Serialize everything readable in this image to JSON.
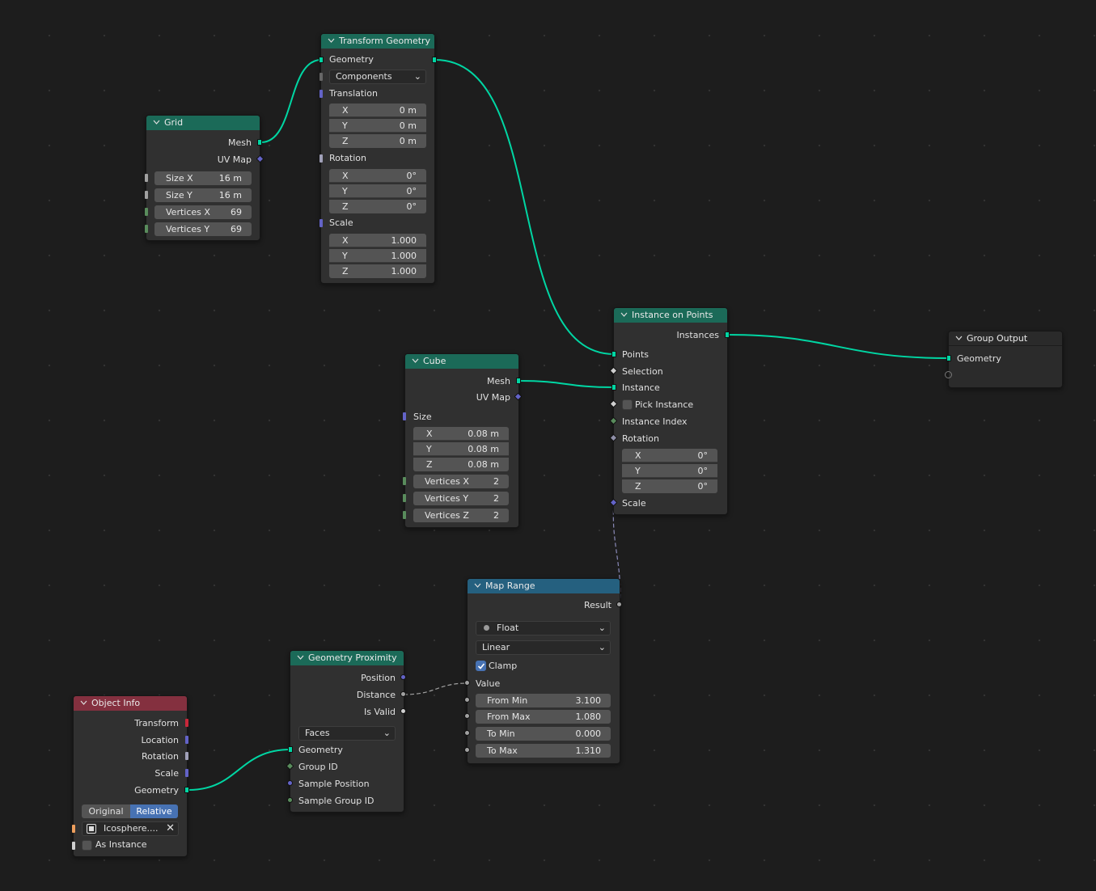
{
  "colors": {
    "background": "#1d1d1d",
    "geometry_header": "#1b6a58",
    "converter_header": "#25607f",
    "input_header": "#84303f",
    "geometry_socket": "#00d6a3",
    "vector_socket": "#6363c7",
    "float_socket": "#a1a1a1",
    "integer_socket": "#598c5c",
    "accent_selected": "#4772b3"
  },
  "nodes": {
    "transform": {
      "title": "Transform Geometry",
      "geometry": "Geometry",
      "mode": "Components",
      "translation": "Translation",
      "translation_values": [
        {
          "axis": "X",
          "value": "0 m"
        },
        {
          "axis": "Y",
          "value": "0 m"
        },
        {
          "axis": "Z",
          "value": "0 m"
        }
      ],
      "rotation": "Rotation",
      "rotation_values": [
        {
          "axis": "X",
          "value": "0°"
        },
        {
          "axis": "Y",
          "value": "0°"
        },
        {
          "axis": "Z",
          "value": "0°"
        }
      ],
      "scale": "Scale",
      "scale_values": [
        {
          "axis": "X",
          "value": "1.000"
        },
        {
          "axis": "Y",
          "value": "1.000"
        },
        {
          "axis": "Z",
          "value": "1.000"
        }
      ]
    },
    "grid": {
      "title": "Grid",
      "mesh": "Mesh",
      "uvmap": "UV Map",
      "fields": [
        {
          "name": "Size X",
          "value": "16 m"
        },
        {
          "name": "Size Y",
          "value": "16 m"
        },
        {
          "name": "Vertices X",
          "value": "69"
        },
        {
          "name": "Vertices Y",
          "value": "69"
        }
      ]
    },
    "instance": {
      "title": "Instance on Points",
      "instances": "Instances",
      "points": "Points",
      "selection": "Selection",
      "instance": "Instance",
      "pick_instance": "Pick Instance",
      "instance_index": "Instance Index",
      "rotation": "Rotation",
      "rotation_values": [
        {
          "axis": "X",
          "value": "0°"
        },
        {
          "axis": "Y",
          "value": "0°"
        },
        {
          "axis": "Z",
          "value": "0°"
        }
      ],
      "scale": "Scale"
    },
    "output": {
      "title": "Group Output",
      "geometry": "Geometry"
    },
    "cube": {
      "title": "Cube",
      "mesh": "Mesh",
      "uvmap": "UV Map",
      "size": "Size",
      "size_values": [
        {
          "axis": "X",
          "value": "0.08 m"
        },
        {
          "axis": "Y",
          "value": "0.08 m"
        },
        {
          "axis": "Z",
          "value": "0.08 m"
        }
      ],
      "fields": [
        {
          "name": "Vertices X",
          "value": "2"
        },
        {
          "name": "Vertices Y",
          "value": "2"
        },
        {
          "name": "Vertices Z",
          "value": "2"
        }
      ]
    },
    "maprange": {
      "title": "Map Range",
      "result": "Result",
      "data_type": "Float",
      "interpolation": "Linear",
      "clamp": "Clamp",
      "clamp_checked": true,
      "value": "Value",
      "fields": [
        {
          "name": "From Min",
          "value": "3.100"
        },
        {
          "name": "From Max",
          "value": "1.080"
        },
        {
          "name": "To Min",
          "value": "0.000"
        },
        {
          "name": "To Max",
          "value": "1.310"
        }
      ]
    },
    "proximity": {
      "title": "Geometry Proximity",
      "position": "Position",
      "distance": "Distance",
      "is_valid": "Is Valid",
      "target_element": "Faces",
      "geometry": "Geometry",
      "group_id": "Group ID",
      "sample_position": "Sample Position",
      "sample_group_id": "Sample Group ID"
    },
    "objinfo": {
      "title": "Object Info",
      "transform": "Transform",
      "location": "Location",
      "rotation": "Rotation",
      "scale": "Scale",
      "geometry": "Geometry",
      "original": "Original",
      "relative": "Relative",
      "object": "Icosphere....",
      "as_instance": "As Instance"
    }
  }
}
